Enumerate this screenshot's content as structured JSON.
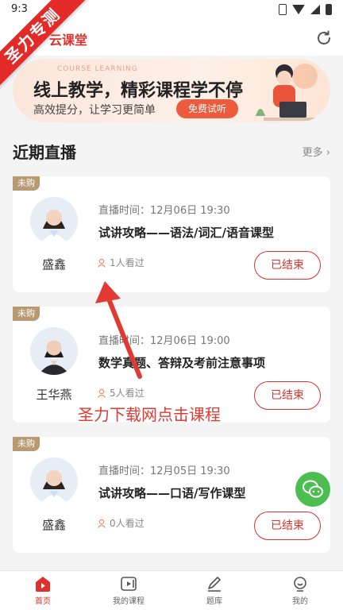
{
  "status_bar": {
    "time": "9:3"
  },
  "ribbon": {
    "text": "圣力专测"
  },
  "header": {
    "app_title": "云课堂"
  },
  "banner": {
    "sub_en": "COURSE LEARNING",
    "headline": "线上教学，精彩课程学不停",
    "tagline": "高效提分，让学习更简单",
    "trial_button": "免费试听"
  },
  "section": {
    "title": "近期直播",
    "more": "更多 ›"
  },
  "cards": [
    {
      "tag": "未购",
      "teacher": "盛鑫",
      "time": "直播时间：12月06日 19:30",
      "course": "试讲攻略——语法/词汇/语音课型",
      "viewers": "1人看过",
      "status": "已结束"
    },
    {
      "tag": "未购",
      "teacher": "王华燕",
      "time": "直播时间：12月06日 19:00",
      "course": "数学真题、答辩及考前注意事项",
      "viewers": "5人看过",
      "status": "已结束"
    },
    {
      "tag": "未购",
      "teacher": "盛鑫",
      "time": "直播时间：12月05日 19:30",
      "course": "试讲攻略——口语/写作课型",
      "viewers": "0人看过",
      "status": "已结束"
    }
  ],
  "overlay": {
    "caption": "圣力下载网点击课程"
  },
  "tabbar": [
    {
      "label": "首页",
      "icon": "home-play-icon",
      "active": true
    },
    {
      "label": "我的课程",
      "icon": "video-icon",
      "active": false
    },
    {
      "label": "题库",
      "icon": "pencil-icon",
      "active": false
    },
    {
      "label": "我的",
      "icon": "user-icon",
      "active": false
    }
  ],
  "colors": {
    "accent": "#e0302b",
    "tag": "#b89a72",
    "wechat": "#4cbe51"
  }
}
